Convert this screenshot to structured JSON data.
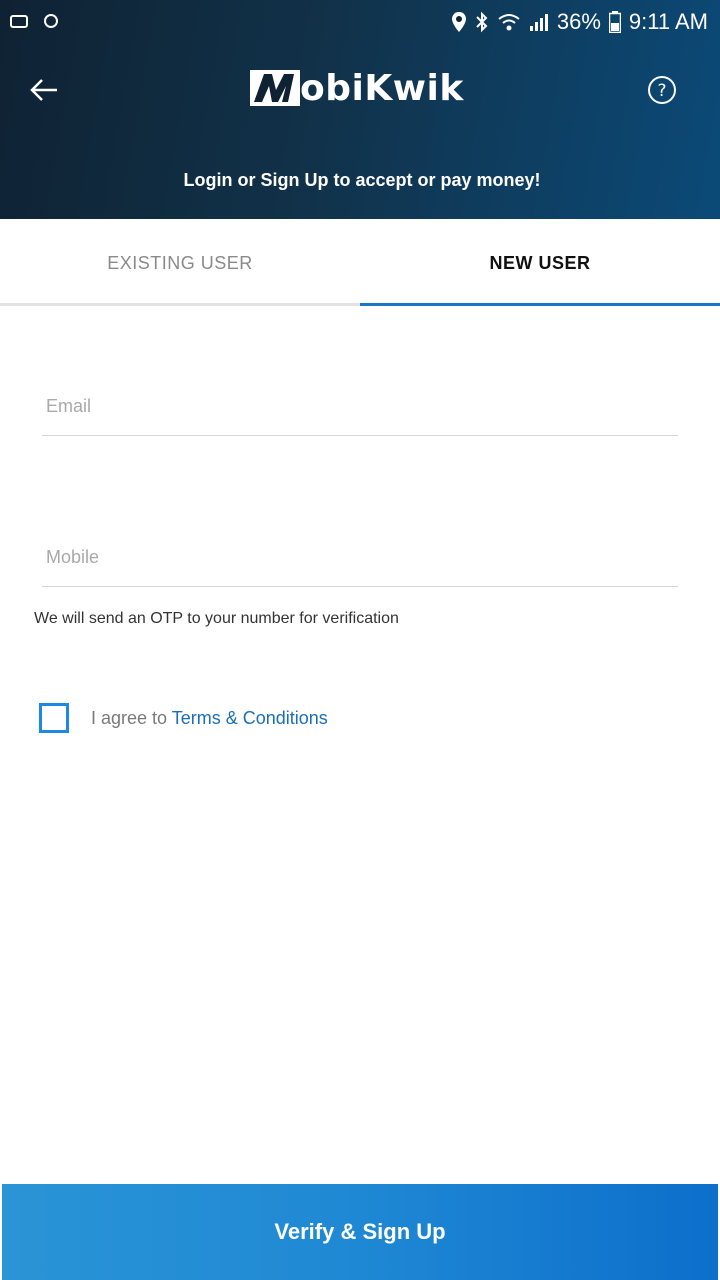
{
  "status_bar": {
    "battery": "36%",
    "time": "9:11 AM"
  },
  "header": {
    "logo_text": "obiKwik",
    "tagline": "Login or Sign Up to accept or pay money!"
  },
  "tabs": [
    {
      "label": "EXISTING USER",
      "active": false
    },
    {
      "label": "NEW USER",
      "active": true
    }
  ],
  "form": {
    "email": {
      "placeholder": "Email",
      "value": ""
    },
    "mobile": {
      "placeholder": "Mobile",
      "value": ""
    },
    "otp_note": "We will send an OTP to your number for verification",
    "terms": {
      "prefix": "I agree to ",
      "link": "Terms & Conditions",
      "checked": false
    }
  },
  "actions": {
    "verify_label": "Verify & Sign Up"
  },
  "colors": {
    "accent": "#1976c8",
    "button": "#1f88d4",
    "header_dark": "#0f2233"
  }
}
